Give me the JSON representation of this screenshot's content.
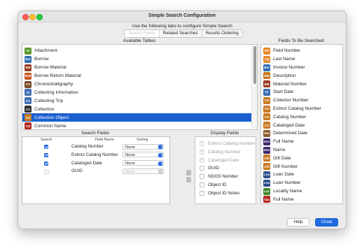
{
  "window": {
    "title": "Simple Search Configuration",
    "instruction": "Use the following tabs to configure Simple Search"
  },
  "tabs": [
    {
      "label": "Search Fields"
    },
    {
      "label": "Related Searches"
    },
    {
      "label": "Results Ordering"
    }
  ],
  "available_tables": {
    "title": "Available Tables",
    "items": [
      {
        "label": "Attachment",
        "icon": "At",
        "color": "#5d9a2e"
      },
      {
        "label": "Borrow",
        "icon": "Bor",
        "color": "#2e6db4"
      },
      {
        "label": "Borrow Material",
        "icon": "BM",
        "color": "#9a3a1e"
      },
      {
        "label": "Borrow Return Material",
        "icon": "BrM",
        "color": "#c9581f"
      },
      {
        "label": "Chronostratigraphy",
        "icon": "CS",
        "color": "#7a4a2a"
      },
      {
        "label": "Collecting Information",
        "icon": "CI",
        "color": "#3f6fb5"
      },
      {
        "label": "Collecting Trip",
        "icon": "CT",
        "color": "#3f6fb5"
      },
      {
        "label": "Collection",
        "icon": "Co",
        "color": "#2f2f2f"
      },
      {
        "label": "Collection Object",
        "icon": "CO",
        "color": "#c9781f",
        "selected": true
      },
      {
        "label": "Common Name",
        "icon": "CN",
        "color": "#b5271f"
      }
    ]
  },
  "fields_searched": {
    "title": "Fields To Be Searched",
    "items": [
      {
        "label": "Field Number",
        "icon": "FN",
        "color": "#e8892a"
      },
      {
        "label": "Last Name",
        "icon": "Ag",
        "color": "#e8892a"
      },
      {
        "label": "Invoice Number",
        "icon": "Bor",
        "color": "#2e6db4"
      },
      {
        "label": "Description",
        "icon": "BM",
        "color": "#c9781f"
      },
      {
        "label": "Material Number",
        "icon": "BM",
        "color": "#9a3a1e"
      },
      {
        "label": "Start Date",
        "icon": "CI",
        "color": "#3f6fb5"
      },
      {
        "label": "Collector Number",
        "icon": "CO",
        "color": "#c9781f"
      },
      {
        "label": "Extinct Catalog Number",
        "icon": "CO",
        "color": "#c9781f"
      },
      {
        "label": "Catalog Number",
        "icon": "CO",
        "color": "#c9781f"
      },
      {
        "label": "Cataloged Date",
        "icon": "CO",
        "color": "#c9781f"
      },
      {
        "label": "Determined Date",
        "icon": "Det",
        "color": "#8c5a2a"
      },
      {
        "label": "Full Name",
        "icon": "Geo",
        "color": "#3b2a6e"
      },
      {
        "label": "Name",
        "icon": "Geo",
        "color": "#3b2a6e"
      },
      {
        "label": "Gift Date",
        "icon": "Gift",
        "color": "#c9781f"
      },
      {
        "label": "Gift Number",
        "icon": "Gift",
        "color": "#c9781f"
      },
      {
        "label": "Loan Date",
        "icon": "Loa",
        "color": "#2e4f8e"
      },
      {
        "label": "Loan Number",
        "icon": "Loa",
        "color": "#2e4f8e"
      },
      {
        "label": "Locality Name",
        "icon": "Loc",
        "color": "#3f8a2a"
      },
      {
        "label": "Full Name",
        "icon": "Tax",
        "color": "#b5271f"
      }
    ]
  },
  "search_fields": {
    "title": "Search Fields",
    "headers": {
      "search": "Search",
      "field_name": "Field Name",
      "sorting": "Sorting"
    },
    "rows": [
      {
        "field": "Catalog Number",
        "sorting": "None",
        "checked": true,
        "enabled": true
      },
      {
        "field": "Extinct Catalog Number",
        "sorting": "None",
        "checked": true,
        "enabled": true
      },
      {
        "field": "Cataloged Date",
        "sorting": "None",
        "checked": true,
        "enabled": true
      },
      {
        "field": "GUID",
        "sorting": "None",
        "checked": false,
        "enabled": false
      }
    ]
  },
  "display_fields": {
    "title": "Display Fields",
    "rows": [
      {
        "label": "Extinct Catalog Number",
        "checked": true,
        "enabled": false
      },
      {
        "label": "Catalog Number",
        "checked": true,
        "enabled": false
      },
      {
        "label": "Cataloged Date",
        "checked": true,
        "enabled": false
      },
      {
        "label": "GUID",
        "checked": false,
        "enabled": true
      },
      {
        "label": "NDGS Number",
        "checked": false,
        "enabled": true
      },
      {
        "label": "Object ID",
        "checked": false,
        "enabled": true
      },
      {
        "label": "Object ID Notes",
        "checked": false,
        "enabled": true
      }
    ]
  },
  "buttons": {
    "help": "Help",
    "close": "Close"
  }
}
